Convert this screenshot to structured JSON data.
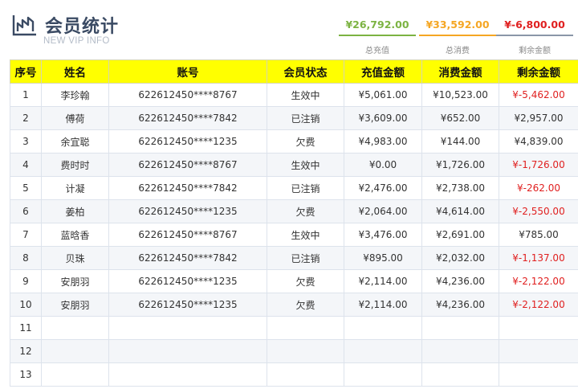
{
  "header": {
    "title": "会员统计",
    "subtitle": "NEW VIP  INFO"
  },
  "stats": [
    {
      "value": "¥26,792.00",
      "label": "总充值",
      "color": "#7cb342"
    },
    {
      "value": "¥33,592.00",
      "label": "总消费",
      "color": "#f5a623"
    },
    {
      "value": "¥-6,800.00",
      "label": "剩余金额",
      "color": "#e02020"
    }
  ],
  "table": {
    "columns": [
      "序号",
      "姓名",
      "账号",
      "会员状态",
      "充值金额",
      "消费金额",
      "剩余金额"
    ],
    "rows": [
      [
        "1",
        "李珍翰",
        "622612450****8767",
        "生效中",
        "¥5,061.00",
        "¥10,523.00",
        "¥-5,462.00"
      ],
      [
        "2",
        "傅荷",
        "622612450****7842",
        "已注销",
        "¥3,609.00",
        "¥652.00",
        "¥2,957.00"
      ],
      [
        "3",
        "余宜聪",
        "622612450****1235",
        "欠费",
        "¥4,983.00",
        "¥144.00",
        "¥4,839.00"
      ],
      [
        "4",
        "费时时",
        "622612450****8767",
        "生效中",
        "¥0.00",
        "¥1,726.00",
        "¥-1,726.00"
      ],
      [
        "5",
        "计凝",
        "622612450****7842",
        "已注销",
        "¥2,476.00",
        "¥2,738.00",
        "¥-262.00"
      ],
      [
        "6",
        "姜柏",
        "622612450****1235",
        "欠费",
        "¥2,064.00",
        "¥4,614.00",
        "¥-2,550.00"
      ],
      [
        "7",
        "蓝晗香",
        "622612450****8767",
        "生效中",
        "¥3,476.00",
        "¥2,691.00",
        "¥785.00"
      ],
      [
        "8",
        "贝珠",
        "622612450****7842",
        "已注销",
        "¥895.00",
        "¥2,032.00",
        "¥-1,137.00"
      ],
      [
        "9",
        "安朋羽",
        "622612450****1235",
        "欠费",
        "¥2,114.00",
        "¥4,236.00",
        "¥-2,122.00"
      ],
      [
        "10",
        "安朋羽",
        "622612450****1235",
        "欠费",
        "¥2,114.00",
        "¥4,236.00",
        "¥-2,122.00"
      ],
      [
        "11",
        "",
        "",
        "",
        "",
        "",
        ""
      ],
      [
        "12",
        "",
        "",
        "",
        "",
        "",
        ""
      ],
      [
        "13",
        "",
        "",
        "",
        "",
        "",
        ""
      ]
    ]
  }
}
